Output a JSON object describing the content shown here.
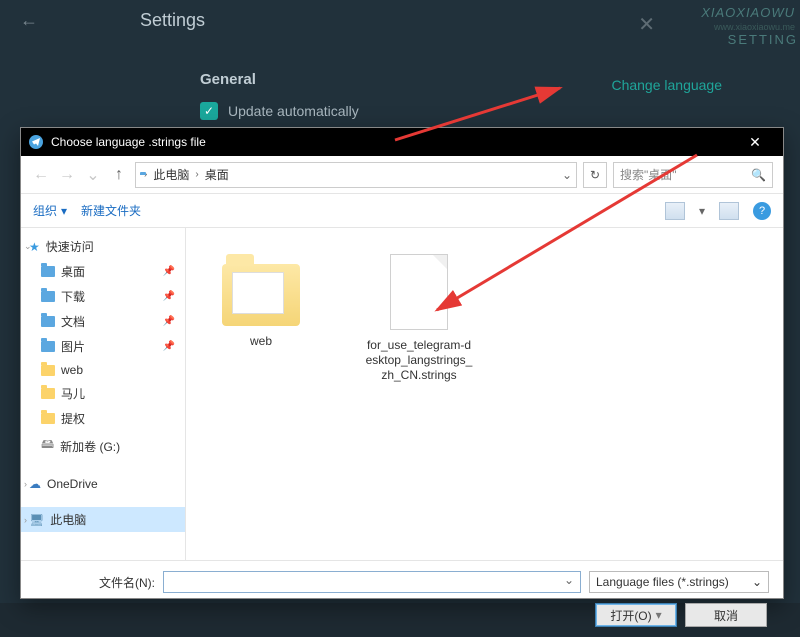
{
  "watermark": {
    "line1": "XIAOXIAOWU",
    "line2": "www.xiaoxiaowu.me",
    "settings_edge": "SETTING"
  },
  "settings": {
    "title": "Settings",
    "general": "General",
    "change_language": "Change language",
    "update_auto": "Update automatically"
  },
  "dialog": {
    "title": "Choose language .strings file",
    "path": {
      "seg1": "此电脑",
      "seg2": "桌面"
    },
    "search_placeholder": "搜索\"桌面\"",
    "toolbar": {
      "organize": "组织",
      "new_folder": "新建文件夹"
    },
    "sidebar": {
      "quick": "快速访问",
      "items": [
        {
          "label": "桌面",
          "pinned": true
        },
        {
          "label": "下载",
          "pinned": true
        },
        {
          "label": "文档",
          "pinned": true
        },
        {
          "label": "图片",
          "pinned": true
        },
        {
          "label": "web",
          "pinned": false
        },
        {
          "label": "马儿",
          "pinned": false
        },
        {
          "label": "提权",
          "pinned": false
        }
      ],
      "drive": "新加卷 (G:)",
      "onedrive": "OneDrive",
      "thispc": "此电脑"
    },
    "files": {
      "folder": "web",
      "file": "for_use_telegram-desktop_langstrings_zh_CN.strings"
    },
    "filename_label": "文件名(N):",
    "filetype": "Language files (*.strings)",
    "open": "打开(O)",
    "cancel": "取消"
  }
}
